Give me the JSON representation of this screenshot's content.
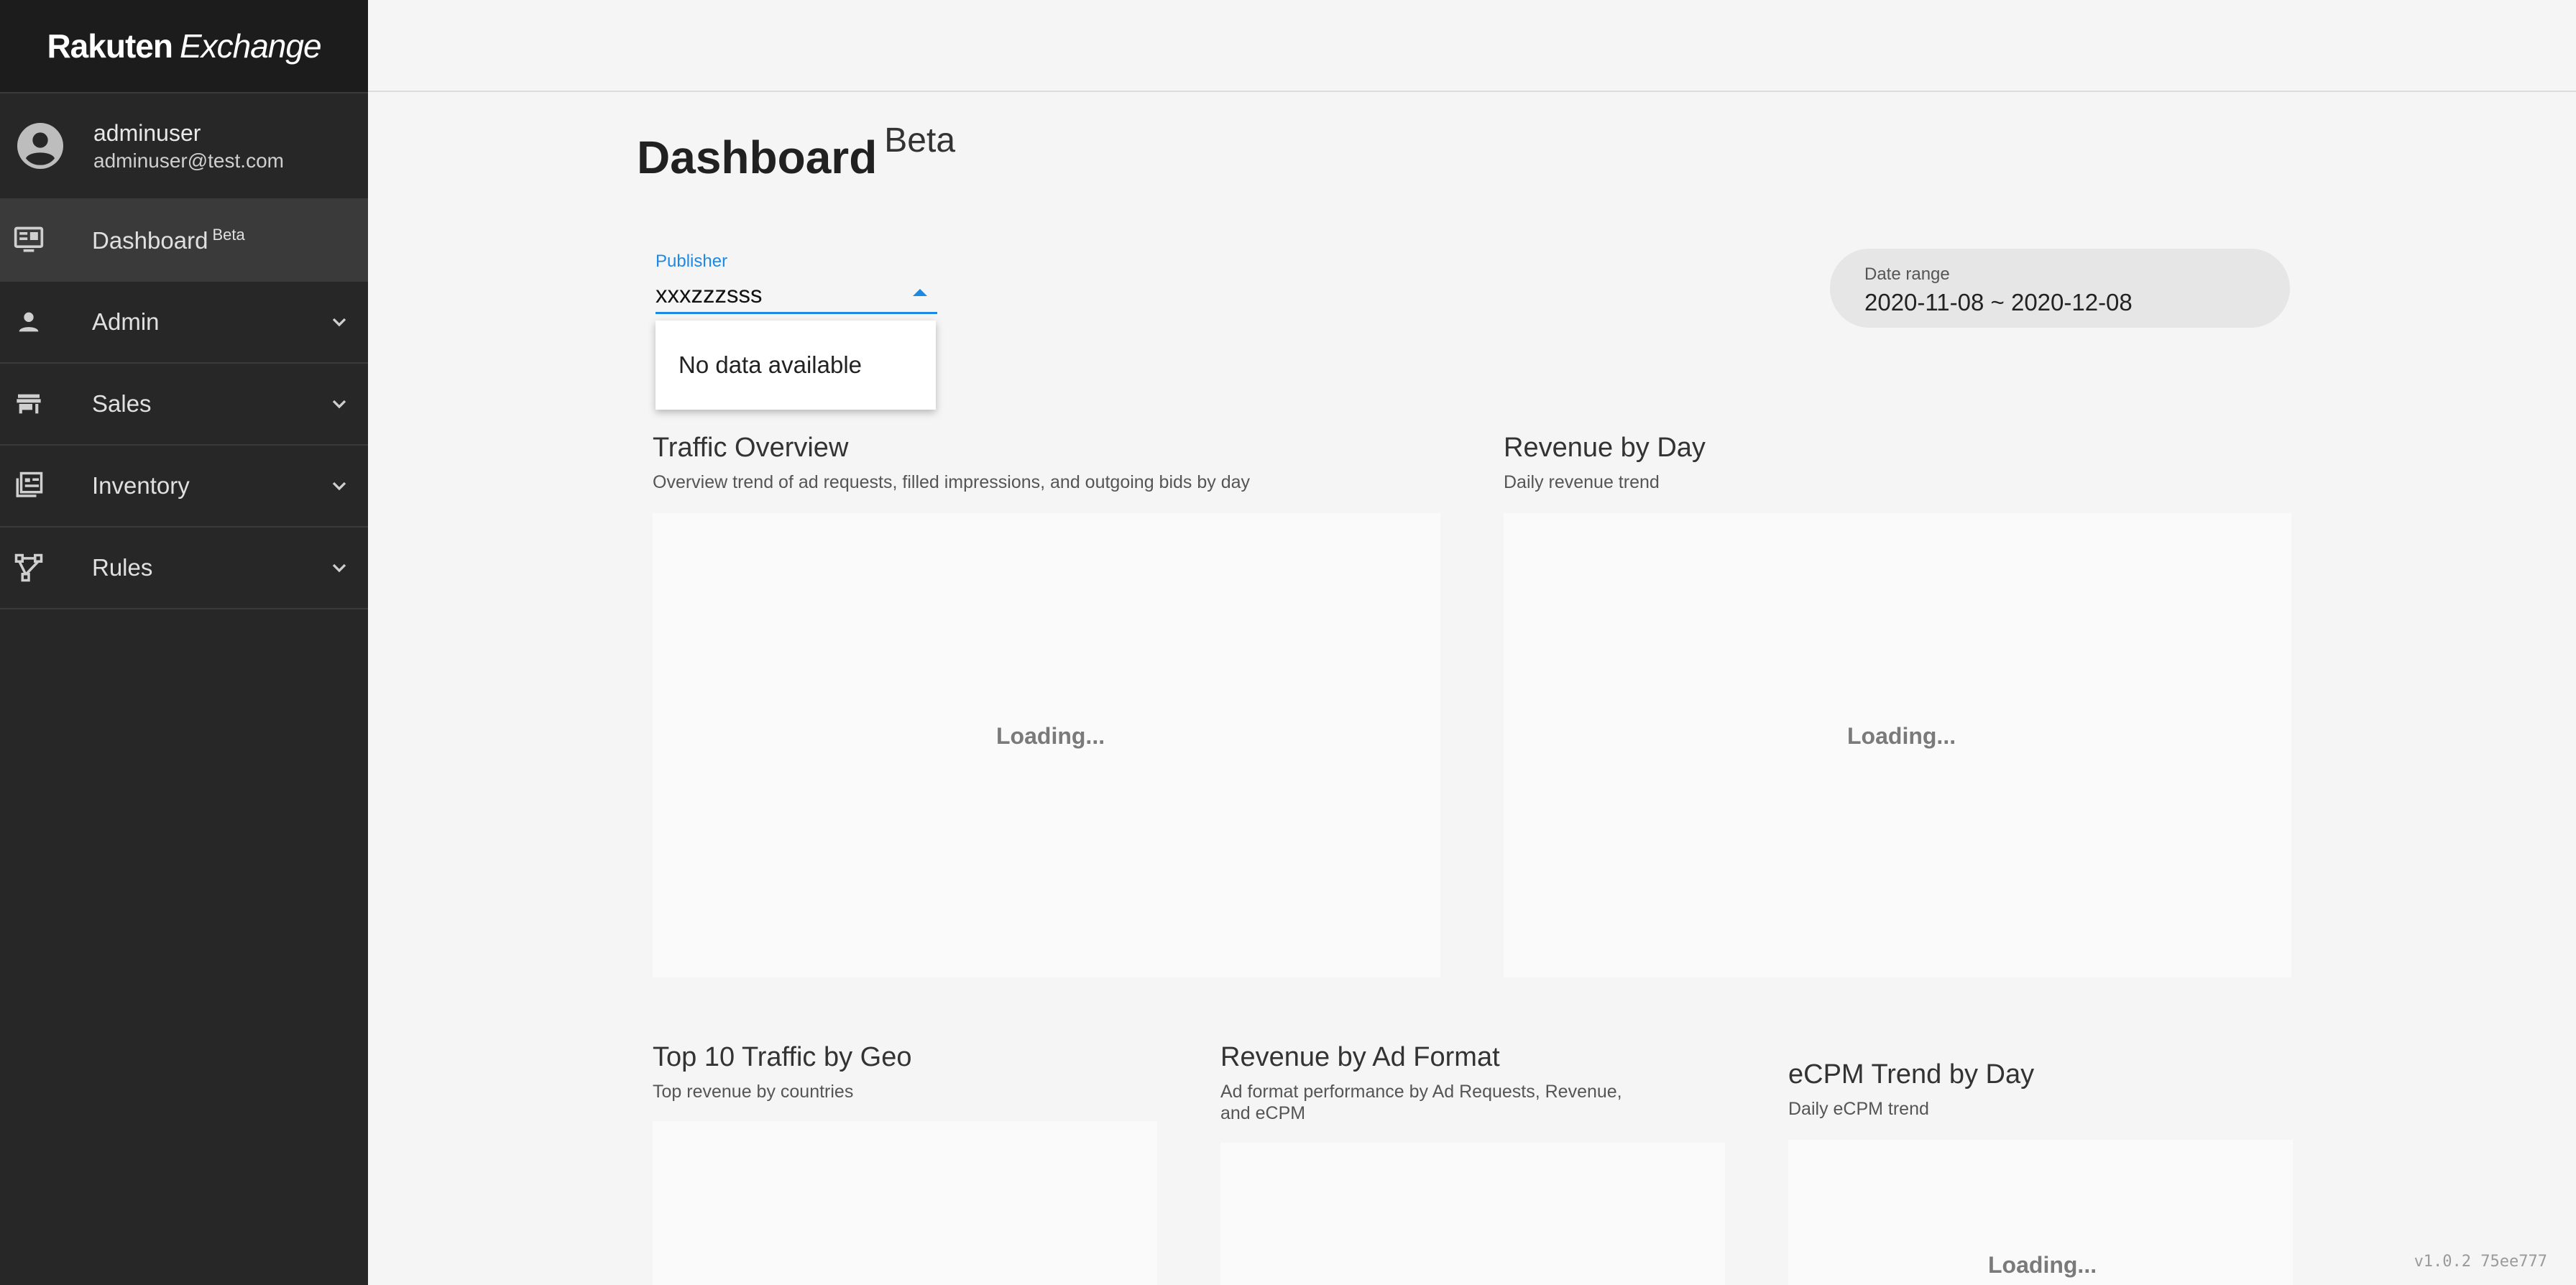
{
  "brand": {
    "part1": "Rakuten",
    "part2": "Exchange"
  },
  "user": {
    "name": "adminuser",
    "email": "adminuser@test.com",
    "icon": "account-circle-icon"
  },
  "nav": {
    "dashboard": {
      "label": "Dashboard",
      "badge": "Beta",
      "icon": "monitor-icon"
    },
    "admin": {
      "label": "Admin",
      "icon": "person-icon"
    },
    "sales": {
      "label": "Sales",
      "icon": "store-icon"
    },
    "inventory": {
      "label": "Inventory",
      "icon": "list-icon"
    },
    "rules": {
      "label": "Rules",
      "icon": "branch-icon"
    }
  },
  "page": {
    "title": "Dashboard",
    "badge": "Beta"
  },
  "publisher": {
    "label": "Publisher",
    "value": "xxxzzzsss"
  },
  "dropdown": {
    "message": "No data available"
  },
  "daterange": {
    "label": "Date range",
    "value": "2020-11-08 ~ 2020-12-08"
  },
  "cards": {
    "traffic": {
      "title": "Traffic Overview",
      "subtitle": "Overview trend of ad requests, filled impressions, and outgoing bids by day",
      "status": "Loading..."
    },
    "revenue": {
      "title": "Revenue by Day",
      "subtitle": "Daily revenue trend",
      "status": "Loading..."
    },
    "geo": {
      "title": "Top 10 Traffic by Geo",
      "subtitle": "Top revenue by countries"
    },
    "adformat": {
      "title": "Revenue by Ad Format",
      "subtitle_line1": "Ad format performance by Ad Requests, Revenue,",
      "subtitle_line2": "and eCPM"
    },
    "ecpm": {
      "title": "eCPM Trend by Day",
      "subtitle": "Daily eCPM trend",
      "status": "Loading..."
    }
  },
  "version": "v1.0.2 75ee777",
  "colors": {
    "accent": "#1e88e5",
    "sidebar": "#272727"
  }
}
